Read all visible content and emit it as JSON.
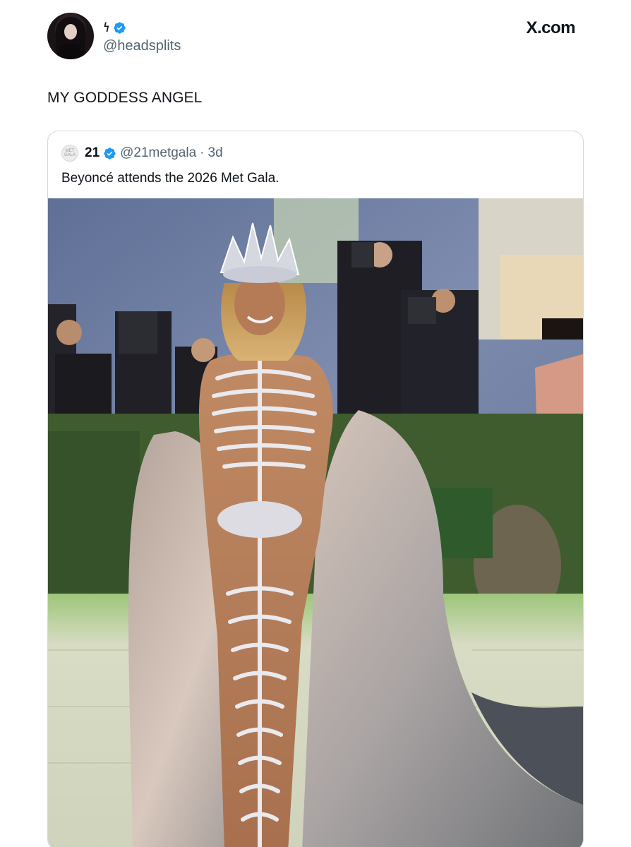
{
  "post": {
    "display_name_glyph": "𐓏",
    "handle": "@headsplits",
    "text": "MY GODDESS ANGEL",
    "brand": "X.com"
  },
  "quoted": {
    "name": "21",
    "handle": "@21metgala",
    "separator": "·",
    "time": "3d",
    "text": "Beyoncé attends the 2026 Met Gala.",
    "avatar_text": "MET GALA"
  },
  "colors": {
    "verified": "#1d9bf0",
    "muted_text": "#536471",
    "border": "#cfd9de"
  },
  "icons": [
    "verified-badge-icon",
    "x-logo-icon"
  ]
}
